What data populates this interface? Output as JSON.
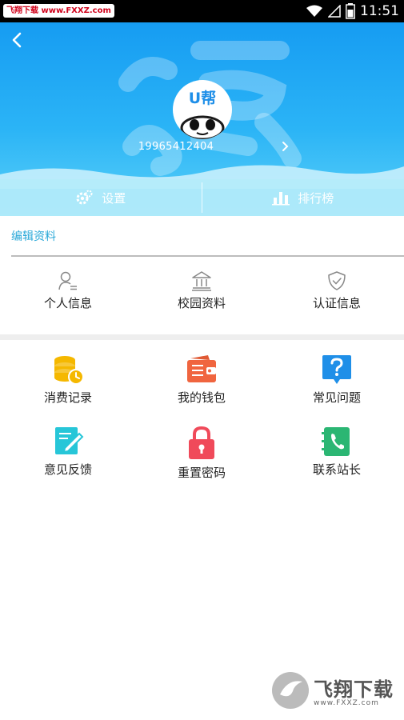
{
  "status_bar": {
    "watermark": "飞翔下载 www.FXXZ.com",
    "time": "11:51"
  },
  "header": {
    "avatar_text": "U帮",
    "phone": "19965412404",
    "quick": [
      {
        "label": "设置",
        "icon": "gear-icon"
      },
      {
        "label": "排行榜",
        "icon": "bar-chart-icon"
      }
    ]
  },
  "edit_profile": {
    "title": "编辑资料",
    "items": [
      {
        "label": "个人信息",
        "icon": "person-icon"
      },
      {
        "label": "校园资料",
        "icon": "building-icon"
      },
      {
        "label": "认证信息",
        "icon": "shield-check-icon"
      }
    ]
  },
  "menu": {
    "items": [
      {
        "label": "消费记录",
        "icon": "coins-clock-icon",
        "color": "#f5b800"
      },
      {
        "label": "我的钱包",
        "icon": "wallet-icon",
        "color": "#f0653f"
      },
      {
        "label": "常见问题",
        "icon": "question-icon",
        "color": "#1f8fe8"
      },
      {
        "label": "意见反馈",
        "icon": "feedback-pen-icon",
        "color": "#27c6d8"
      },
      {
        "label": "重置密码",
        "icon": "lock-icon",
        "color": "#f04a5a"
      },
      {
        "label": "联系站长",
        "icon": "phone-book-icon",
        "color": "#2bb673"
      }
    ]
  },
  "watermark_bottom": {
    "title": "飞翔下载",
    "url": "www.FXXZ.com"
  }
}
